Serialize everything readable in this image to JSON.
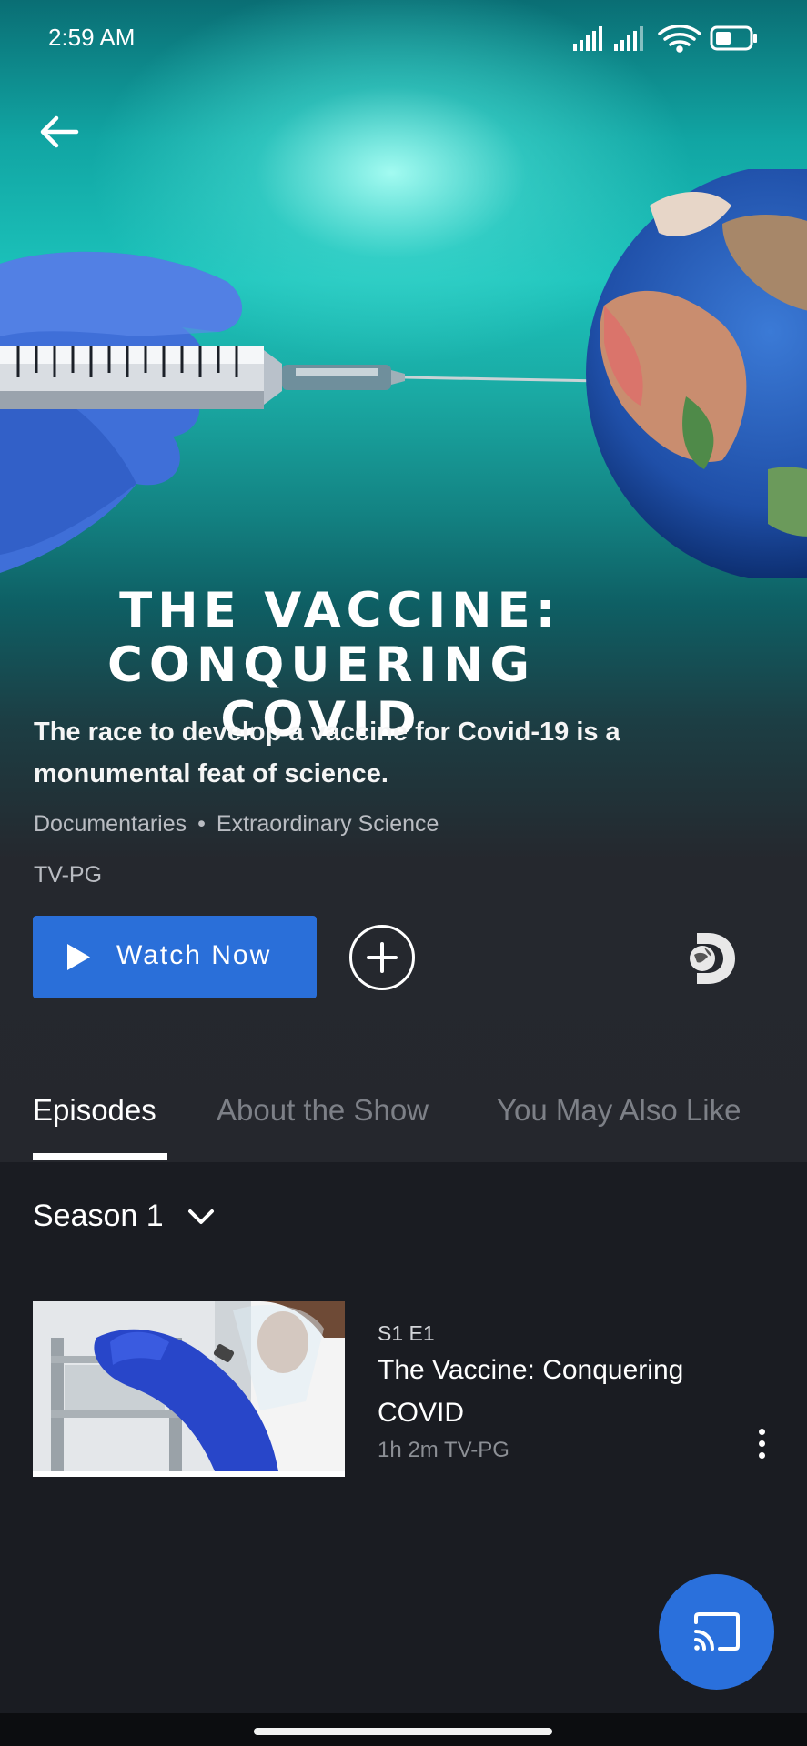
{
  "status_bar": {
    "time": "2:59 AM",
    "icons": [
      "signal-icon",
      "signal-icon",
      "wifi-icon",
      "battery-icon"
    ]
  },
  "hero": {
    "title_line1": "THE VACCINE:",
    "title_line2": "CONQUERING COVID",
    "tagline": "The race to develop a vaccine for Covid-19 is a monumental feat of science.",
    "genre_primary": "Documentaries",
    "separator": "•",
    "genre_secondary": "Extraordinary Science",
    "rating": "TV-PG"
  },
  "actions": {
    "watch_label": "Watch Now"
  },
  "tabs": [
    {
      "label": "Episodes",
      "active": true
    },
    {
      "label": "About the Show",
      "active": false
    },
    {
      "label": "You May Also Like",
      "active": false
    }
  ],
  "season": {
    "label": "Season 1"
  },
  "episodes": [
    {
      "number": "S1 E1",
      "title": "The Vaccine: Conquering COVID",
      "meta": "1h 2m TV-PG"
    }
  ],
  "colors": {
    "accent": "#2a6fd9",
    "background": "#1a1c22",
    "hero_teal": "#1cc3bb"
  }
}
